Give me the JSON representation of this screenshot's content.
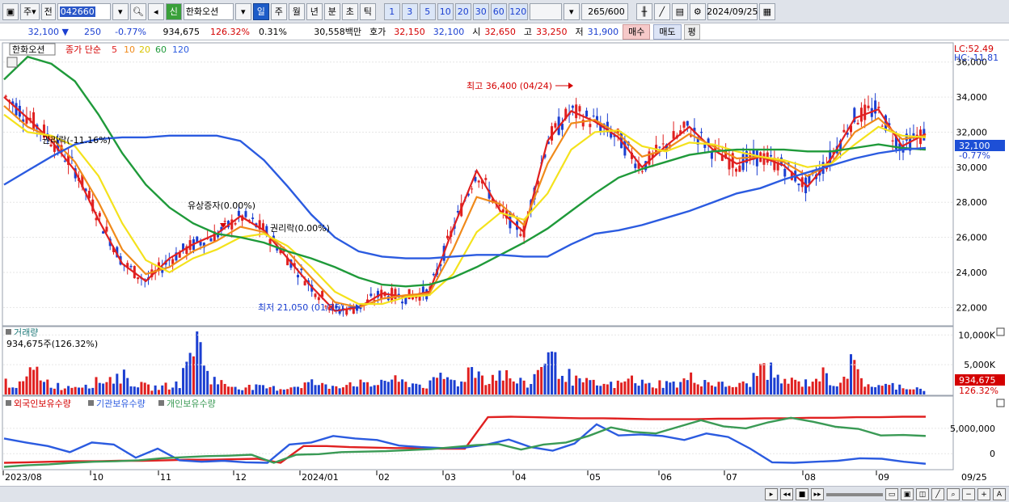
{
  "toolbar": {
    "market_label": "주",
    "jeon_label": "전",
    "stock_code": "042660",
    "sin_badge": "신",
    "stock_name": "한화오션",
    "periods": [
      "일",
      "주",
      "월",
      "년",
      "분",
      "초",
      "틱"
    ],
    "active_period": "일",
    "minutes": [
      "1",
      "3",
      "5",
      "10",
      "20",
      "30",
      "60",
      "120"
    ],
    "count_value": "265",
    "count_max": "/600",
    "date": "2024/09/25"
  },
  "quote": {
    "price": "32,100",
    "change": "250",
    "change_pct": "-0.77%",
    "volume": "934,675",
    "vol_ratio": "126.32%",
    "turnover": "0.31%",
    "amount": "30,558백만",
    "ask_label": "호가",
    "ask1": "32,150",
    "ask2": "32,100",
    "open_label": "시",
    "open": "32,650",
    "high_label": "고",
    "high": "33,250",
    "low_label": "저",
    "low": "31,900",
    "buy_button": "매수",
    "sell_button": "매도",
    "flat_button": "평"
  },
  "price_pane": {
    "stock_tag": "한화오션",
    "ma_label": "종가 단순",
    "ma_periods": [
      "5",
      "10",
      "20",
      "60",
      "120"
    ],
    "lc": "LC:52.49",
    "hc": "HC:-11.81",
    "current_tag": "32,100",
    "current_pct": "-0.77%",
    "axis_ticks": [
      "36,000",
      "34,000",
      "32,000",
      "30,000",
      "28,000",
      "26,000",
      "24,000",
      "22,000"
    ],
    "ann_high": "최고 36,400 (04/24)",
    "ann_low": "최저 21,050 (01/25)",
    "ann_rights": "권리락(-11.16%)",
    "ann_rights2": "유상증자(0.00%)",
    "ann_rights3": "권리락(0.00%)"
  },
  "volume_pane": {
    "title": "거래량",
    "subtitle": "934,675주(126.32%)",
    "axis_ticks": [
      "10,000K",
      "5,000K"
    ],
    "current_tag": "934,675",
    "current_pct": "126.32%"
  },
  "holding_pane": {
    "legend": [
      "외국인보유수량",
      "기관보유수량",
      "개인보유수량"
    ],
    "axis_ticks": [
      "5,000,000",
      "0"
    ]
  },
  "x_axis": [
    "2023/08",
    "10",
    "11",
    "12",
    "2024/01",
    "02",
    "03",
    "04",
    "05",
    "06",
    "07",
    "08",
    "09",
    "09/25"
  ],
  "colors": {
    "ma5": "#e02020",
    "ma10": "#f08a1a",
    "ma20": "#f4e21c",
    "ma60": "#1f9a3a",
    "ma120": "#2b5be0",
    "up": "#e02020",
    "down": "#1c3fd1",
    "foreign": "#e02020",
    "inst": "#2b5be0",
    "retail": "#3a9a55"
  },
  "chart_data": [
    {
      "type": "line",
      "title": "한화오션",
      "series": [
        {
          "name": "5",
          "values": [
            34000,
            32800,
            31500,
            29800,
            27000,
            24500,
            23500,
            24800,
            25600,
            26200,
            27200,
            26400,
            24800,
            23200,
            21800,
            22000,
            22800,
            22600,
            22900,
            26500,
            29800,
            27500,
            26300,
            31500,
            33200,
            32600,
            31700,
            30000,
            31200,
            32300,
            31000,
            30200,
            30600,
            30100,
            28900,
            30500,
            32800,
            33300,
            31200,
            31900
          ]
        },
        {
          "name": "10",
          "values": [
            33500,
            32300,
            31700,
            30300,
            28000,
            25300,
            23900,
            24300,
            25200,
            25800,
            26600,
            26300,
            25200,
            23700,
            22300,
            22000,
            22500,
            22700,
            22800,
            25300,
            28300,
            27900,
            26700,
            30200,
            32500,
            32700,
            31900,
            30600,
            31000,
            31900,
            31200,
            30500,
            30600,
            30300,
            29500,
            30200,
            32000,
            32800,
            31600,
            31800
          ]
        },
        {
          "name": "20",
          "values": [
            33000,
            32000,
            31800,
            31200,
            29500,
            26800,
            24700,
            24000,
            24800,
            25300,
            26000,
            26200,
            25500,
            24300,
            22900,
            22200,
            22200,
            22600,
            22700,
            23900,
            26300,
            27400,
            27000,
            28500,
            31000,
            32000,
            32100,
            31200,
            30900,
            31400,
            31300,
            30900,
            30600,
            30400,
            30000,
            30200,
            31300,
            32300,
            31800,
            31700
          ]
        },
        {
          "name": "60",
          "values": [
            35000,
            36300,
            35900,
            34900,
            33000,
            30800,
            29000,
            27700,
            26800,
            26200,
            26000,
            25700,
            25200,
            24800,
            24300,
            23700,
            23300,
            23200,
            23300,
            23700,
            24300,
            25000,
            25700,
            26500,
            27500,
            28500,
            29400,
            29900,
            30300,
            30700,
            30900,
            31000,
            31000,
            31000,
            30900,
            30900,
            31100,
            31300,
            31100,
            31000
          ]
        },
        {
          "name": "120",
          "values": [
            29000,
            29800,
            30600,
            31300,
            31600,
            31700,
            31700,
            31800,
            31800,
            31800,
            31500,
            30400,
            28900,
            27300,
            26000,
            25200,
            24900,
            24800,
            24800,
            24900,
            25000,
            25000,
            24900,
            24900,
            25600,
            26200,
            26400,
            26700,
            27100,
            27500,
            28000,
            28500,
            28800,
            29300,
            29700,
            30100,
            30500,
            30800,
            31000,
            31100
          ]
        }
      ],
      "ylim": [
        21000,
        37000
      ]
    },
    {
      "type": "bar",
      "title": "거래량",
      "values_k": [
        2100,
        1500,
        4200,
        1800,
        1200,
        1600,
        1900,
        2600,
        3100,
        1700,
        1100,
        1400,
        1900,
        9800,
        2900,
        1600,
        1300,
        1200,
        1100,
        1000,
        1500,
        2000,
        1300,
        1700,
        2100,
        1300,
        2600,
        2100,
        1800,
        1500,
        3000,
        1900,
        4500,
        2500,
        3700,
        2100,
        1600,
        6900,
        4400,
        2300,
        1900,
        1500,
        1700,
        2600,
        1500,
        1900,
        1700,
        2700,
        2200,
        1600,
        1400,
        1800,
        5000,
        2400,
        2100,
        1900,
        3400,
        1700,
        4900,
        1800,
        1300,
        1500,
        1200,
        934.675
      ],
      "ylim": [
        0,
        11000
      ]
    },
    {
      "type": "line",
      "title": "보유수량",
      "series": [
        {
          "name": "외국인보유수량",
          "values": [
            -1800000,
            -1700000,
            -1600000,
            -1500000,
            -1500000,
            -1400000,
            -1400000,
            -1300000,
            -1200000,
            -1200000,
            -1100000,
            -1000000,
            -1800000,
            1500000,
            1500000,
            1300000,
            1200000,
            1100000,
            1100000,
            1000000,
            1000000,
            7200000,
            7300000,
            7200000,
            7100000,
            7000000,
            7000000,
            6900000,
            6800000,
            6800000,
            6800000,
            6900000,
            6900000,
            7000000,
            7000000,
            7100000,
            7100000,
            7200000,
            7200000,
            7300000,
            7300000
          ]
        },
        {
          "name": "기관보유수량",
          "values": [
            3000000,
            2200000,
            1500000,
            300000,
            2200000,
            1800000,
            -800000,
            1000000,
            -1300000,
            -1600000,
            -1400000,
            -1700000,
            -1800000,
            1800000,
            2200000,
            3500000,
            3000000,
            2700000,
            1600000,
            1300000,
            1100000,
            1200000,
            1800000,
            2800000,
            1300000,
            600000,
            2000000,
            5800000,
            3600000,
            3800000,
            3500000,
            2700000,
            4000000,
            3300000,
            1000000,
            -1700000,
            -1800000,
            -1600000,
            -1400000,
            -900000,
            -1000000,
            -1600000,
            -2000000
          ]
        },
        {
          "name": "개인보유수량",
          "values": [
            -2600000,
            -2300000,
            -2100000,
            -1800000,
            -1600000,
            -1500000,
            -1300000,
            -900000,
            -700000,
            -500000,
            -400000,
            -200000,
            -1800000,
            -200000,
            -100000,
            300000,
            400000,
            500000,
            700000,
            900000,
            1300000,
            1700000,
            1900000,
            800000,
            1800000,
            2200000,
            3500000,
            5200000,
            4300000,
            4000000,
            5300000,
            6600000,
            5400000,
            5000000,
            6200000,
            7100000,
            6300000,
            5300000,
            4900000,
            3600000,
            3700000,
            3500000
          ]
        }
      ],
      "ylim": [
        -3000000,
        8500000
      ]
    }
  ]
}
